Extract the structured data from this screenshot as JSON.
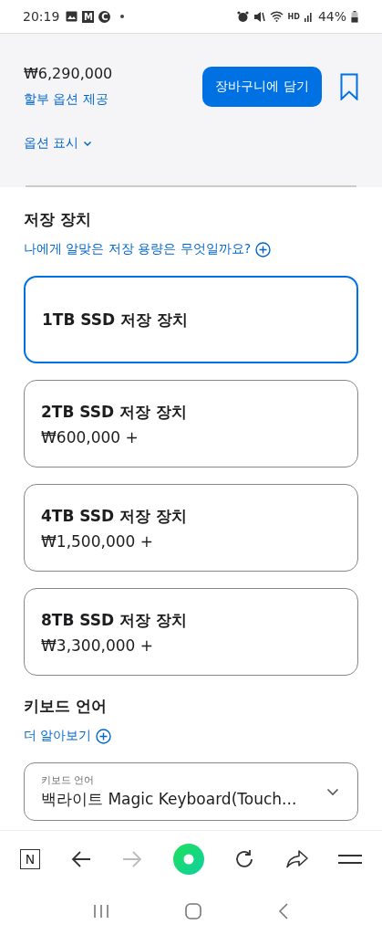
{
  "status_bar": {
    "time": "20:19",
    "app_badges": [
      "M",
      "C"
    ],
    "network_label": "HD",
    "battery": "44%"
  },
  "purchase_bar": {
    "price": "₩6,290,000",
    "installment_link": "할부 옵션 제공",
    "add_to_bag_button": "장바구니에 담기",
    "options_toggle": "옵션 표시",
    "bookmarked": false
  },
  "storage": {
    "heading": "저장 장치",
    "help_link": "나에게 알맞은 저장 용량은 무엇일까요?",
    "options": [
      {
        "label": "1TB SSD 저장 장치",
        "selected": true
      },
      {
        "label": "2TB SSD 저장 장치",
        "price": "₩600,000 +",
        "selected": false
      },
      {
        "label": "4TB SSD 저장 장치",
        "price": "₩1,500,000 +",
        "selected": false
      },
      {
        "label": "8TB SSD 저장 장치",
        "price": "₩3,300,000 +",
        "selected": false
      }
    ]
  },
  "keyboard": {
    "heading": "키보드 언어",
    "help_link": "더 알아보기",
    "select": {
      "label": "키보드 언어",
      "value": "백라이트 Magic Keyboard(Touch..."
    }
  },
  "browser_toolbar": {
    "tabs_button": "N"
  }
}
